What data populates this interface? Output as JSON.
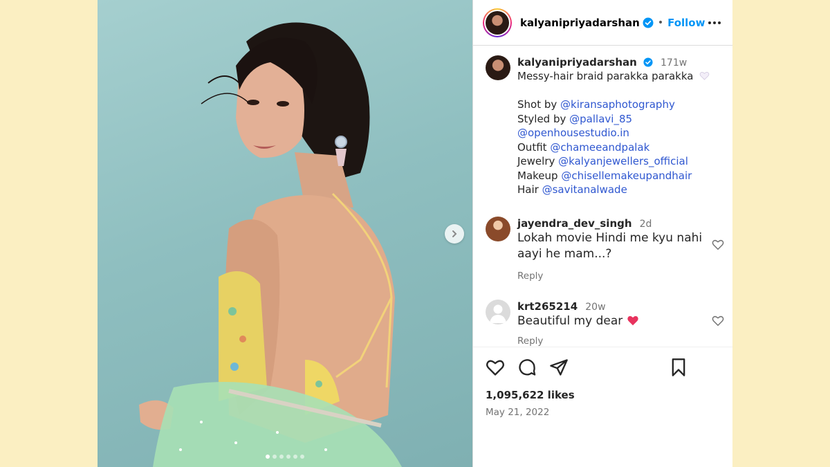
{
  "colors": {
    "page_bg": "#fbefc2",
    "link_blue": "#2f57d0",
    "follow_blue": "#0095f6",
    "verified_blue": "#0095f6",
    "heart_pink": "#e8335e"
  },
  "header": {
    "username": "kalyanipriyadarshan",
    "separator": "•",
    "follow_label": "Follow",
    "more_icon": "more-horizontal-icon"
  },
  "caption": {
    "username": "kalyanipriyadarshan",
    "time": "171w",
    "line1": "Messy-hair braid parakka parakka",
    "shot_by_label": "Shot by",
    "shot_by_handle": "@kiransaphotography",
    "styled_by_label": "Styled by",
    "styled_by_handle": "@pallavi_85",
    "studio_handle": "@openhousestudio.in",
    "outfit_label": "Outfit",
    "outfit_handle": "@chameeandpalak",
    "jewelry_label": "Jewelry",
    "jewelry_handle": "@kalyanjewellers_official",
    "makeup_label": "Makeup",
    "makeup_handle": "@chisellemakeupandhair",
    "hair_label": "Hair",
    "hair_handle": "@savitanalwade"
  },
  "comments": [
    {
      "username": "jayendra_dev_singh",
      "time": "2d",
      "text": "Lokah movie Hindi me kyu nahi aayi he mam...?",
      "reply_label": "Reply"
    },
    {
      "username": "krt265214",
      "time": "20w",
      "text": "Beautiful my dear",
      "reply_label": "Reply"
    }
  ],
  "actions": {
    "like_icon": "heart-icon",
    "comment_icon": "comment-icon",
    "share_icon": "send-icon",
    "save_icon": "bookmark-icon"
  },
  "stats": {
    "likes": "1,095,622 likes",
    "date": "May 21, 2022"
  },
  "carousel": {
    "slide_count": 6,
    "active_index": 0
  }
}
